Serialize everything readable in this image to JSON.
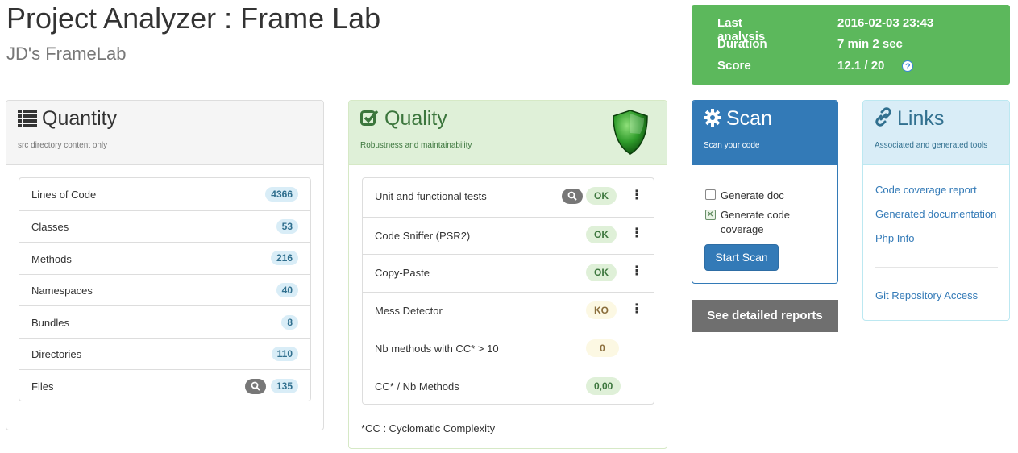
{
  "header": {
    "title": "Project Analyzer : Frame Lab",
    "subtitle": "JD's FrameLab"
  },
  "summary": {
    "color": "#5cb85c",
    "rows": [
      {
        "label": "Last analysis",
        "value": "2016-02-03 23:43"
      },
      {
        "label": "Duration",
        "value": "7 min 2 sec"
      },
      {
        "label": "Score",
        "value": "12.1 / 20"
      }
    ],
    "help_icon": "question-circle-icon",
    "help_glyph": "?"
  },
  "quantity": {
    "title": "Quantity",
    "subtitle": "src directory content only",
    "icon": "list-icon",
    "items": [
      {
        "label": "Lines of Code",
        "value": "4366"
      },
      {
        "label": "Classes",
        "value": "53"
      },
      {
        "label": "Methods",
        "value": "216"
      },
      {
        "label": "Namespaces",
        "value": "40"
      },
      {
        "label": "Bundles",
        "value": "8"
      },
      {
        "label": "Directories",
        "value": "110"
      },
      {
        "label": "Files",
        "value": "135"
      }
    ]
  },
  "quality": {
    "title": "Quality",
    "subtitle": "Robustness and maintainability",
    "icon": "checkbox-icon",
    "shield_icon": "green-shield-icon",
    "items": [
      {
        "label": "Unit and functional tests",
        "value": "OK",
        "status": "ok"
      },
      {
        "label": "Code Sniffer (PSR2)",
        "value": "OK",
        "status": "ok"
      },
      {
        "label": "Copy-Paste",
        "value": "OK",
        "status": "ok"
      },
      {
        "label": "Mess Detector",
        "value": "KO",
        "status": "ko"
      },
      {
        "label": "Nb methods with CC* > 10",
        "value": "0",
        "status": "ko"
      },
      {
        "label": "CC* / Nb Methods",
        "value": "0,00",
        "status": "ok"
      }
    ],
    "note": "*CC : Cyclomatic Complexity"
  },
  "scan": {
    "title": "Scan",
    "subtitle": "Scan your code",
    "icon": "gear-icon",
    "options": [
      {
        "label": "Generate doc",
        "checked": false
      },
      {
        "label": "Generate code coverage",
        "checked": true
      }
    ],
    "button": "Start Scan"
  },
  "reports_button": "See detailed reports",
  "links": {
    "title": "Links",
    "subtitle": "Associated and generated tools",
    "icon": "link-icon",
    "items": [
      {
        "label": "Code coverage report"
      },
      {
        "label": "Generated documentation"
      },
      {
        "label": "Php Info"
      }
    ],
    "extra": "Git Repository Access"
  }
}
